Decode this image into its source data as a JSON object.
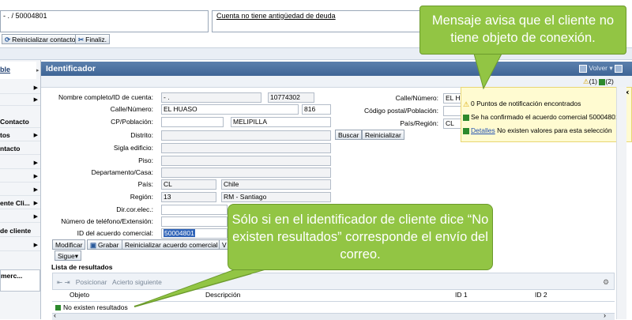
{
  "header": {
    "account_ref": "- . / 50004801",
    "message_link": "Cuenta no tiene antigüedad de deuda",
    "reset_contact_button": "Reinicializar contacto",
    "finish_button": "Finaliz."
  },
  "logo_text": "ble",
  "sidebar": {
    "items": [
      {
        "label": ""
      },
      {
        "label": ""
      },
      {
        "label": "Contacto"
      },
      {
        "label": "tos"
      },
      {
        "label": "ntacto"
      },
      {
        "label": ""
      },
      {
        "label": ""
      },
      {
        "label": ""
      },
      {
        "label": "ente Cli..."
      },
      {
        "label": ""
      },
      {
        "label": "de cliente"
      },
      {
        "label": ""
      },
      {
        "label": "merc..."
      }
    ]
  },
  "panel": {
    "title": "Identificador",
    "back_button": "Volver",
    "alert_count": "(1)",
    "info_count": "(2)"
  },
  "form": {
    "name_label": "Nombre completo/ID de cuenta:",
    "name_value": "- .",
    "name_id": "10774302",
    "street_label": "Calle/Número:",
    "street_value": "EL HUASO",
    "street_number": "816",
    "cp_label": "CP/Población:",
    "cp_city": "MELIPILLA",
    "district_label": "Distrito:",
    "building_label": "Sigla edificio:",
    "floor_label": "Piso:",
    "apartment_label": "Departamento/Casa:",
    "country_label": "País:",
    "country_code": "CL",
    "country_name": "Chile",
    "region_label": "Región:",
    "region_code": "13",
    "region_name": "RM - Santiago",
    "email_label": "Dir.cor.elec.:",
    "phone_label": "Número de teléfono/Extensión:",
    "agreement_label": "ID del acuerdo comercial:",
    "agreement_value": "50004801"
  },
  "right_form": {
    "street_label": "Calle/Número:",
    "street_value": "EL HU",
    "postal_label": "Código postal/Población:",
    "country_label": "País/Región:",
    "country_value": "CL",
    "search_button": "Buscar",
    "reset_button": "Reinicializar"
  },
  "actions": {
    "modify": "Modificar",
    "save": "Grabar",
    "reset_agreement": "Reinicializar acuerdo comercial",
    "v": "V",
    "next": "Sigue"
  },
  "results": {
    "title": "Lista de resultados",
    "position_button": "Posicionar",
    "next_hit_button": "Acierto siguiente",
    "columns": [
      "Objeto",
      "Descripción",
      "ID 1",
      "ID 2"
    ],
    "empty_message": "No existen resultados"
  },
  "notifications": {
    "summary": "0 Puntos de notificación encontrados",
    "confirmed": "Se ha confirmado el acuerdo comercial 50004801",
    "details_link": "Detalles",
    "details_text": "No existen valores para esta selección"
  },
  "callouts": {
    "top": "Mensaje avisa que el cliente no tiene objeto de conexión.",
    "bottom": "Sólo si en el identificador de cliente dice “No existen resultados” corresponde el envío del correo."
  },
  "colors": {
    "panel_header": "#4a6fa0",
    "callout": "#92c544",
    "notification": "#fffbd1"
  }
}
